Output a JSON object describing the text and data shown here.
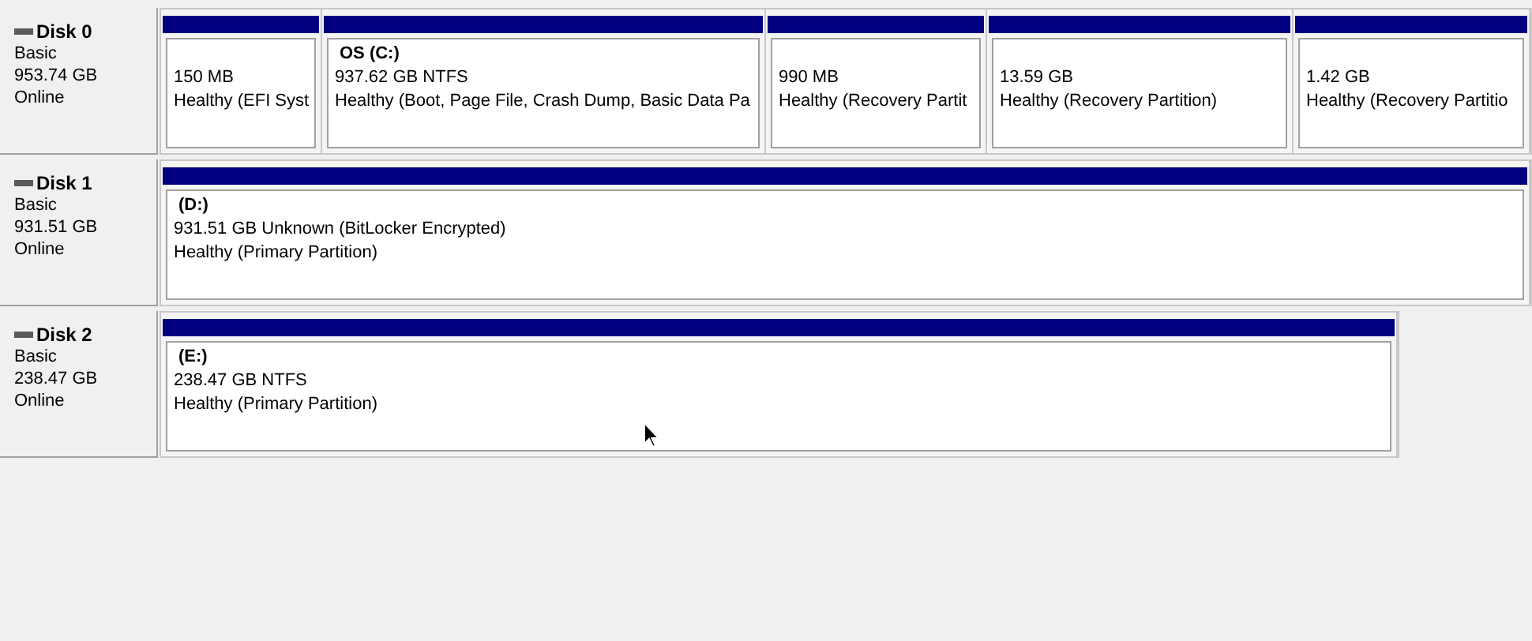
{
  "disks": [
    {
      "name": "Disk 0",
      "type": "Basic",
      "size": "953.74 GB",
      "status": "Online",
      "partitions": [
        {
          "size": "150 MB",
          "status": "Healthy (EFI Syst"
        },
        {
          "label": "OS  (C:)",
          "size": "937.62 GB NTFS",
          "status": "Healthy (Boot, Page File, Crash Dump, Basic Data Pa"
        },
        {
          "size": "990 MB",
          "status": "Healthy (Recovery Partit"
        },
        {
          "size": "13.59 GB",
          "status": "Healthy (Recovery Partition)"
        },
        {
          "size": "1.42 GB",
          "status": "Healthy (Recovery Partitio"
        }
      ]
    },
    {
      "name": "Disk 1",
      "type": "Basic",
      "size": "931.51 GB",
      "status": "Online",
      "partitions": [
        {
          "label": "(D:)",
          "size": "931.51 GB Unknown (BitLocker Encrypted)",
          "status": "Healthy (Primary Partition)"
        }
      ]
    },
    {
      "name": "Disk 2",
      "type": "Basic",
      "size": "238.47 GB",
      "status": "Online",
      "partitions": [
        {
          "label": "(E:)",
          "size": "238.47 GB NTFS",
          "status": "Healthy (Primary Partition)"
        }
      ]
    }
  ]
}
